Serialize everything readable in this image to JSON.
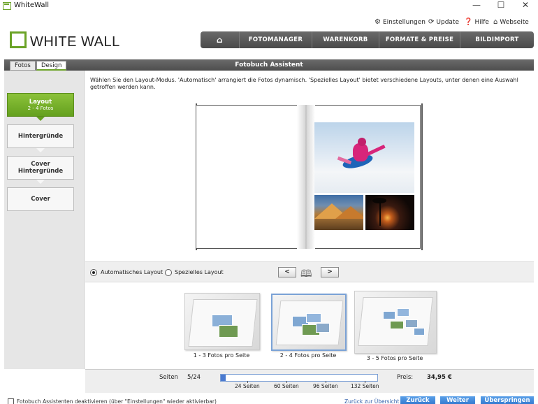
{
  "window": {
    "title": "WhiteWall",
    "controls": [
      "—",
      "☐",
      "✕"
    ]
  },
  "top_links": [
    {
      "label": "Einstellungen",
      "icon": "gear-icon"
    },
    {
      "label": "Update",
      "icon": "update-icon"
    },
    {
      "label": "Hilfe",
      "icon": "help-icon"
    },
    {
      "label": "Webseite",
      "icon": "home-icon"
    }
  ],
  "logo": {
    "text": "WHITE WALL"
  },
  "nav": {
    "home_icon": "⌂",
    "items": [
      "FOTOMANAGER",
      "WARENKORB",
      "FORMATE & PREISE",
      "BILDIMPORT"
    ]
  },
  "tabs": {
    "fotos": "Fotos",
    "design": "Design",
    "active": "Design"
  },
  "assistant": {
    "title": "Fotobuch Assistent"
  },
  "steps": [
    {
      "label": "Layout",
      "sub": "2 - 4 Fotos",
      "active": true
    },
    {
      "label": "Hintergründe",
      "sub": "",
      "active": false
    },
    {
      "label": "Cover Hintergründe",
      "sub": "",
      "active": false
    },
    {
      "label": "Cover",
      "sub": "",
      "active": false
    }
  ],
  "instructions": "Wählen Sie den Layout-Modus. 'Automatisch' arrangiert die Fotos dynamisch. 'Spezielles Layout' bietet verschiedene Layouts, unter denen eine Auswahl getroffen werden kann.",
  "layout_mode": {
    "options": [
      "Automatisches Layout",
      "Spezielles Layout"
    ],
    "selected": "Automatisches Layout",
    "prev": "<",
    "next": ">"
  },
  "thumbnails": [
    {
      "label": "1 - 3 Fotos pro Seite",
      "selected": false
    },
    {
      "label": "2 - 4 Fotos pro Seite",
      "selected": true
    },
    {
      "label": "3 - 5 Fotos pro Seite",
      "selected": false
    }
  ],
  "stats": {
    "pages_label": "Seiten",
    "pages_value": "5/24",
    "progress_fraction": 0.03,
    "ticks": [
      "24 Seiten",
      "60 Seiten",
      "96 Seiten",
      "132 Seiten"
    ],
    "price_label": "Preis:",
    "price_value": "34,95 €"
  },
  "footer": {
    "deactivate_label": "Fotobuch Assistenten deaktivieren (über \"Einstellungen\" wieder aktivierbar)",
    "back_overview": "Zurück zur Übersicht",
    "buttons": [
      "Zurück",
      "Weiter",
      "Überspringen"
    ]
  },
  "colors": {
    "accent_green": "#6ba327",
    "nav_dark": "#4a4a4a",
    "button_blue": "#2e74cc"
  }
}
